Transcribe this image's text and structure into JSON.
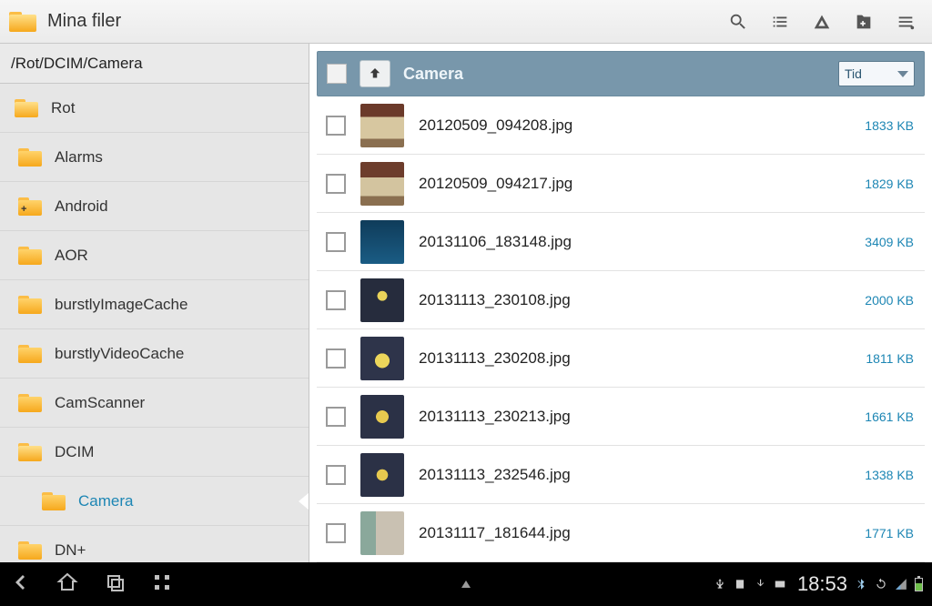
{
  "app": {
    "title": "Mina filer"
  },
  "path": "/Rot/DCIM/Camera",
  "sidebar": {
    "items": [
      {
        "label": "Rot",
        "depth": 0,
        "open": true
      },
      {
        "label": "Alarms",
        "depth": 1
      },
      {
        "label": "Android",
        "depth": 1,
        "badge": "+"
      },
      {
        "label": "AOR",
        "depth": 1
      },
      {
        "label": "burstlyImageCache",
        "depth": 1
      },
      {
        "label": "burstlyVideoCache",
        "depth": 1
      },
      {
        "label": "CamScanner",
        "depth": 1
      },
      {
        "label": "DCIM",
        "depth": 1,
        "open": true
      },
      {
        "label": "Camera",
        "depth": 2,
        "active": true
      },
      {
        "label": "DN+",
        "depth": 1
      }
    ]
  },
  "list": {
    "folder_name": "Camera",
    "sort_label": "Tid",
    "files": [
      {
        "name": "20120509_094208.jpg",
        "size": "1833 KB",
        "thumb": "th-room1"
      },
      {
        "name": "20120509_094217.jpg",
        "size": "1829 KB",
        "thumb": "th-room2"
      },
      {
        "name": "20131106_183148.jpg",
        "size": "3409 KB",
        "thumb": "th-blue"
      },
      {
        "name": "20131113_230108.jpg",
        "size": "2000 KB",
        "thumb": "th-flower1"
      },
      {
        "name": "20131113_230208.jpg",
        "size": "1811 KB",
        "thumb": "th-flower2"
      },
      {
        "name": "20131113_230213.jpg",
        "size": "1661 KB",
        "thumb": "th-flower3"
      },
      {
        "name": "20131113_232546.jpg",
        "size": "1338 KB",
        "thumb": "th-flower4"
      },
      {
        "name": "20131117_181644.jpg",
        "size": "1771 KB",
        "thumb": "th-indoor"
      }
    ]
  },
  "status": {
    "clock": "18:53"
  },
  "icons": {
    "search": "search-icon",
    "list": "list-view-icon",
    "share": "share-icon",
    "newfolder": "new-folder-icon",
    "menu": "menu-icon",
    "back": "back-icon",
    "home": "home-icon",
    "recent": "recent-apps-icon",
    "qr": "scan-icon",
    "caret": "expand-caret-icon",
    "up": "up-folder-icon"
  }
}
